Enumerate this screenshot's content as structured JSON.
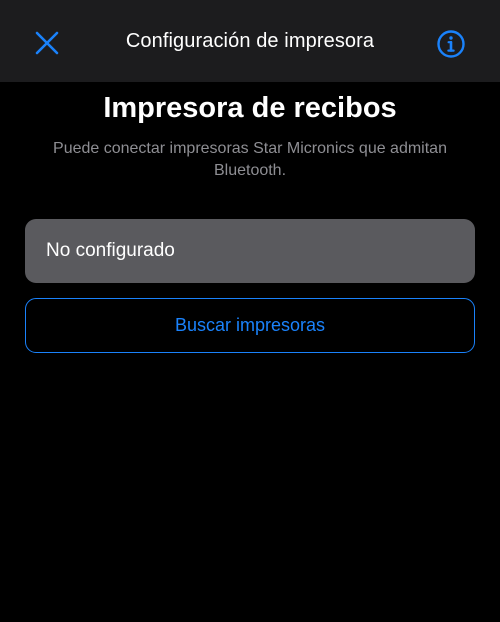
{
  "nav": {
    "title": "Configuración de impresora",
    "close_icon": "close-icon",
    "info_icon": "info-icon"
  },
  "main": {
    "heading": "Impresora de recibos",
    "subtitle": "Puede conectar impresoras Star Micronics que admitan Bluetooth.",
    "status_value": "No configurado",
    "search_button_label": "Buscar impresoras"
  },
  "colors": {
    "accent": "#1a82fb",
    "background": "#000000",
    "nav_background": "#1c1c1e",
    "field_background": "#5a5a5e",
    "secondary_text": "#8e8e93"
  }
}
